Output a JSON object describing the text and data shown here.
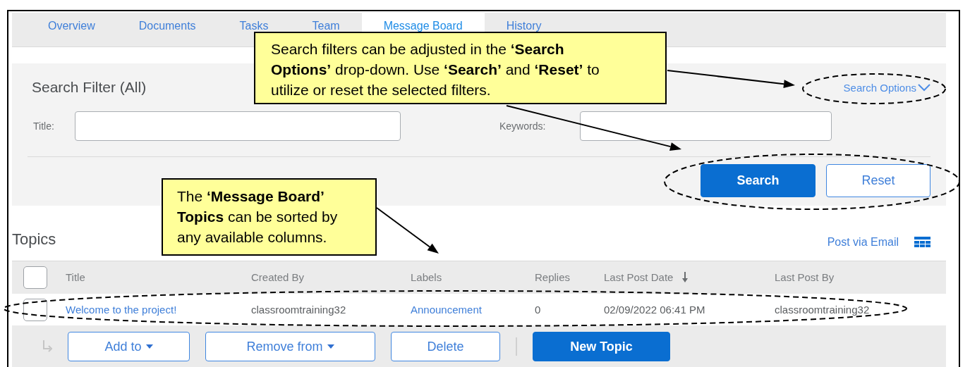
{
  "tabs": [
    {
      "label": "Overview",
      "selected": false
    },
    {
      "label": "Documents",
      "selected": false
    },
    {
      "label": "Tasks",
      "selected": false
    },
    {
      "label": "Team",
      "selected": false
    },
    {
      "label": "Message Board",
      "selected": true
    },
    {
      "label": "History",
      "selected": false
    }
  ],
  "search_filter": {
    "title": "Search Filter (All)",
    "options_link": "Search Options",
    "fields": [
      {
        "label": "Title:"
      },
      {
        "label": "Keywords:"
      }
    ],
    "buttons": [
      {
        "label": "Search",
        "kind": "primary"
      },
      {
        "label": "Reset",
        "kind": "secondary"
      }
    ]
  },
  "topics": {
    "title": "Topics",
    "post_link": "Post via Email",
    "header_checked": false,
    "columns": [
      {
        "label": "Title",
        "sorted": false
      },
      {
        "label": "Created By",
        "sorted": false
      },
      {
        "label": "Labels",
        "sorted": false
      },
      {
        "label": "Replies",
        "sorted": false
      },
      {
        "label": "Last Post Date",
        "sorted": true
      },
      {
        "label": "Last Post By",
        "sorted": false
      }
    ],
    "rows": [
      {
        "checked": false,
        "cells": [
          {
            "text": "Welcome to the project!",
            "kind": "link"
          },
          {
            "text": "classroomtraining32",
            "kind": "text"
          },
          {
            "text": "Announcement",
            "kind": "link"
          },
          {
            "text": "0",
            "kind": "text"
          },
          {
            "text": "02/09/2022 06:41 PM",
            "kind": "text"
          },
          {
            "text": "classroomtraining32",
            "kind": "text"
          }
        ]
      }
    ],
    "actions": [
      {
        "label": "Add to",
        "kind": "menu"
      },
      {
        "label": "Remove from",
        "kind": "menu"
      },
      {
        "label": "Delete",
        "kind": "plain"
      },
      {
        "label": "New Topic",
        "kind": "primary"
      }
    ]
  },
  "callouts": [
    {
      "text": "Search filters can be adjusted in the **‘Search Options’** drop-down. Use **‘Search’** and **‘Reset’** to utilize or reset the selected filters."
    },
    {
      "text": "The **‘Message Board’ Topics** can be sorted by any available columns."
    }
  ]
}
